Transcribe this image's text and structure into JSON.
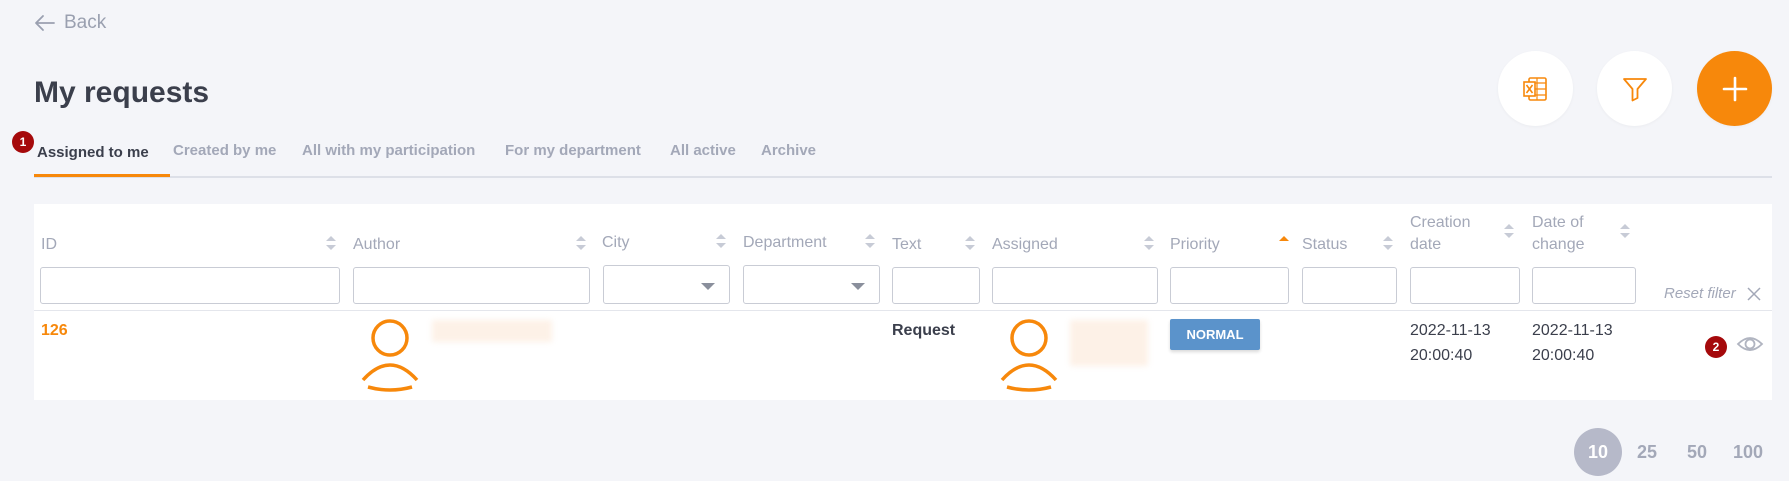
{
  "nav": {
    "back_label": "Back"
  },
  "page": {
    "title": "My requests"
  },
  "tabs": [
    {
      "label": "Assigned to me",
      "active": true
    },
    {
      "label": "Created by me"
    },
    {
      "label": "All with my participation"
    },
    {
      "label": "For my department"
    },
    {
      "label": "All active"
    },
    {
      "label": "Archive"
    }
  ],
  "badges": {
    "first": "1",
    "second": "2"
  },
  "table": {
    "columns": [
      {
        "key": "id",
        "label": "ID"
      },
      {
        "key": "author",
        "label": "Author"
      },
      {
        "key": "city",
        "label": "City"
      },
      {
        "key": "department",
        "label": "Department"
      },
      {
        "key": "text",
        "label": "Text"
      },
      {
        "key": "assigned",
        "label": "Assigned"
      },
      {
        "key": "priority",
        "label": "Priority",
        "sort": "asc"
      },
      {
        "key": "status",
        "label": "Status"
      },
      {
        "key": "creation_date",
        "label_line1": "Creation",
        "label_line2": "date"
      },
      {
        "key": "date_of_change",
        "label_line1": "Date of",
        "label_line2": "change"
      }
    ],
    "reset_filter_label": "Reset filter",
    "rows": [
      {
        "id": "126",
        "text": "Request",
        "priority": "NORMAL",
        "creation_date": "2022-11-13",
        "creation_time": "20:00:40",
        "change_date": "2022-11-13",
        "change_time": "20:00:40"
      }
    ]
  },
  "pagination": {
    "sizes": [
      "10",
      "25",
      "50",
      "100"
    ],
    "active": "10"
  },
  "colors": {
    "accent": "#f7880b",
    "priority_normal": "#5b93cb",
    "badge": "#a5090b",
    "background": "#f4f5f9"
  },
  "icons": {
    "back": "arrow-left-icon",
    "excel": "excel-export-icon",
    "filter": "funnel-icon",
    "add": "plus-icon",
    "reset": "close-icon",
    "view": "eye-icon",
    "avatar": "user-avatar-icon"
  }
}
